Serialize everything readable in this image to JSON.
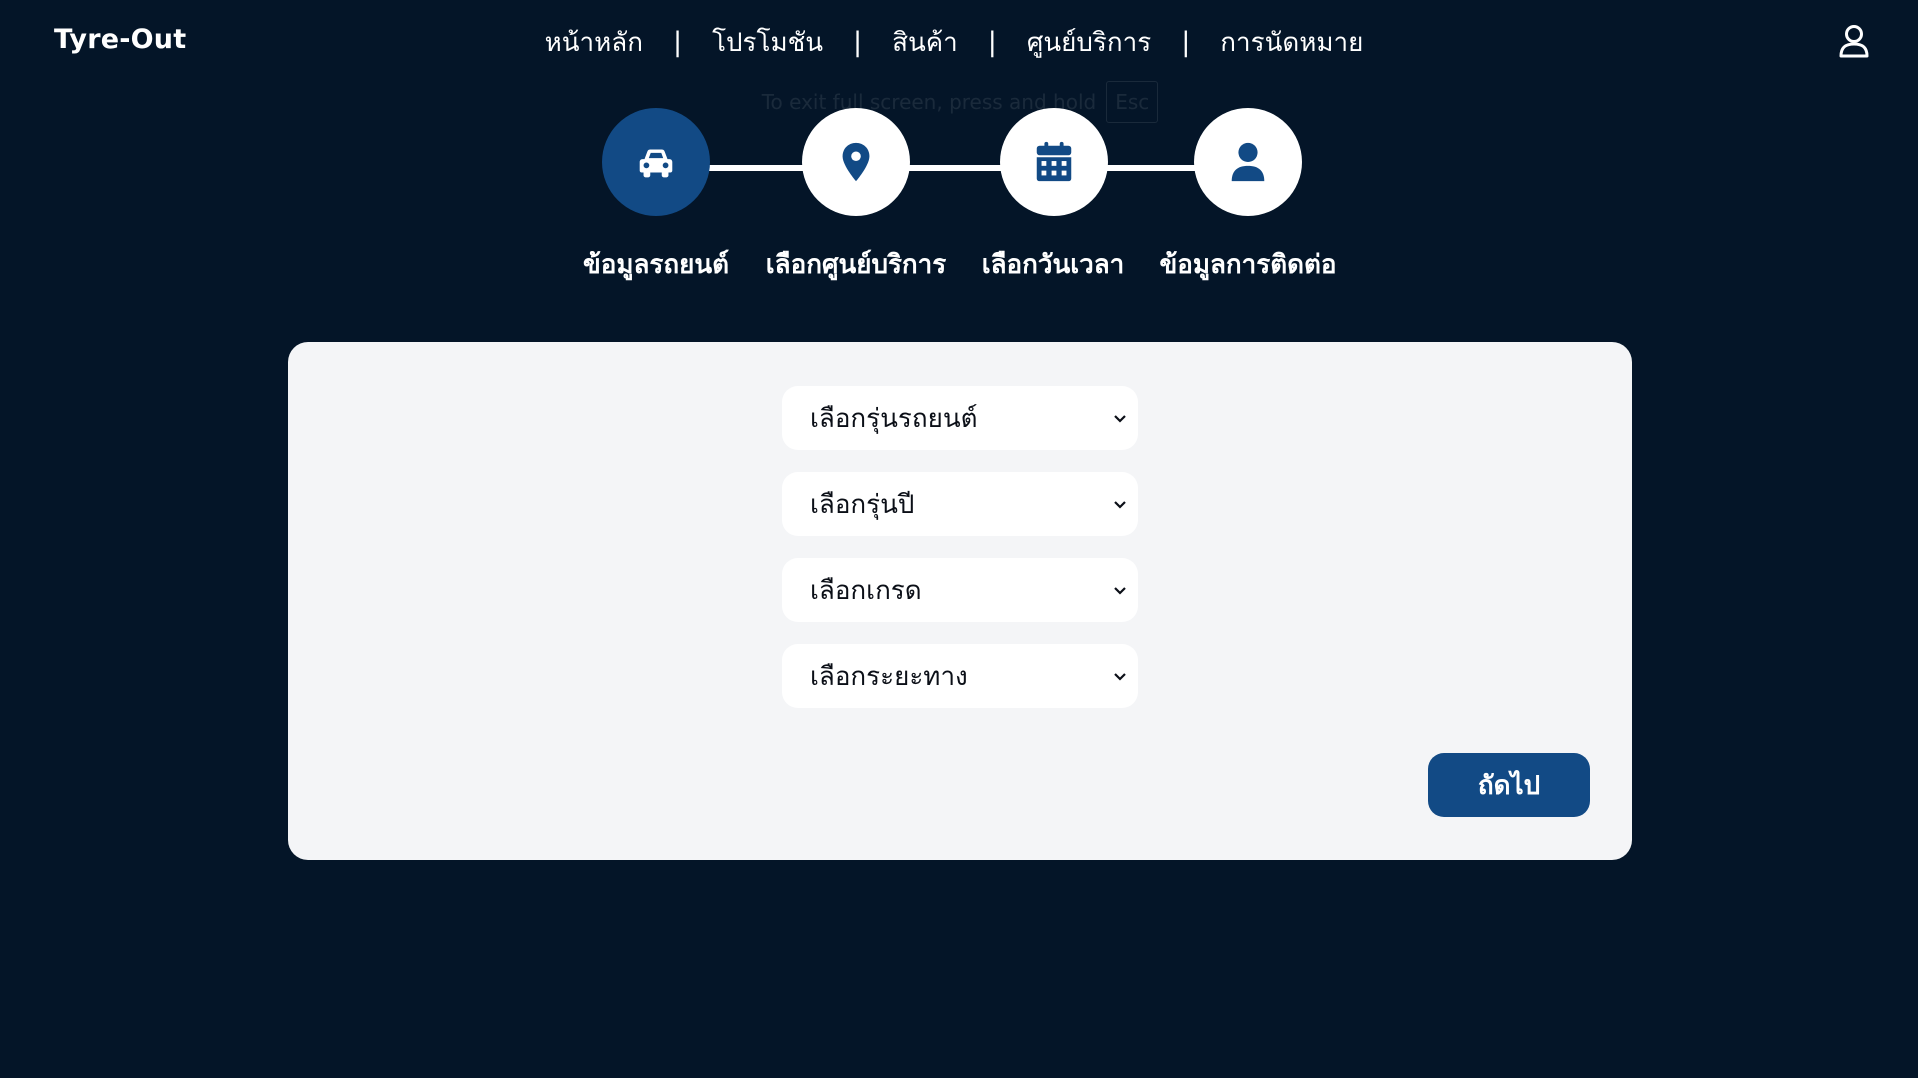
{
  "app": {
    "logo": "Tyre-Out"
  },
  "nav": {
    "items": [
      "หน้าหลัก",
      "โปรโมชัน",
      "สินค้า",
      "ศูนย์บริการ",
      "การนัดหมาย"
    ],
    "separator": "|"
  },
  "header_icons": {
    "user": "user-icon"
  },
  "fullscreen_notice": {
    "text": "To exit full screen, press and hold",
    "key": "Esc"
  },
  "steps": [
    {
      "label": "ข้อมูลรถยนต์",
      "icon": "car-icon",
      "active": true
    },
    {
      "label": "เลือกศูนย์บริการ",
      "icon": "map-pin-icon",
      "active": false
    },
    {
      "label": "เลือกวันเวลา",
      "icon": "calendar-icon",
      "active": false
    },
    {
      "label": "ข้อมูลการติดต่อ",
      "icon": "person-icon",
      "active": false
    }
  ],
  "form": {
    "selects": [
      {
        "value": "เลือกรุ่นรถยนต์"
      },
      {
        "value": "เลือกรุ่นปี"
      },
      {
        "value": "เลือกเกรด"
      },
      {
        "value": "เลือกระยะทาง"
      }
    ],
    "next_label": "ถัดไป"
  },
  "colors": {
    "background": "#041528",
    "accent": "#124a85",
    "card": "#f4f5f7",
    "step_inactive": "#ffffff"
  }
}
